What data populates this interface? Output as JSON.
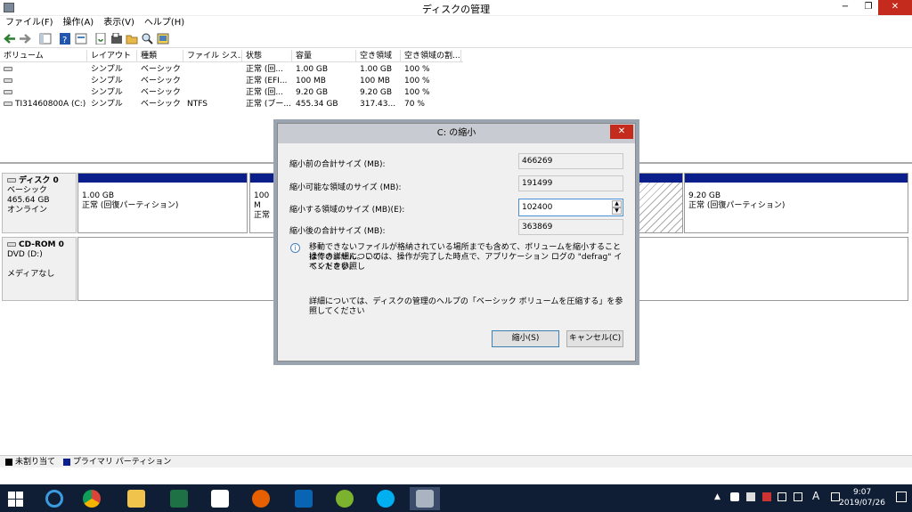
{
  "window": {
    "title": "ディスクの管理",
    "minimize": "−",
    "restore": "❐",
    "close": "✕"
  },
  "menu": [
    "ファイル(F)",
    "操作(A)",
    "表示(V)",
    "ヘルプ(H)"
  ],
  "volume_list": {
    "columns": [
      "ボリューム",
      "レイアウト",
      "種類",
      "ファイル シス...",
      "状態",
      "容量",
      "空き領域",
      "空き領域の割..."
    ],
    "rows": [
      [
        "",
        "シンプル",
        "ベーシック",
        "",
        "正常 (回...",
        "1.00 GB",
        "1.00 GB",
        "100 %"
      ],
      [
        "",
        "シンプル",
        "ベーシック",
        "",
        "正常 (EFI...",
        "100 MB",
        "100 MB",
        "100 %"
      ],
      [
        "",
        "シンプル",
        "ベーシック",
        "",
        "正常 (回...",
        "9.20 GB",
        "9.20 GB",
        "100 %"
      ],
      [
        "TI31460800A (C:)",
        "シンプル",
        "ベーシック",
        "NTFS",
        "正常 (ブー...",
        "455.34 GB",
        "317.43...",
        "70 %"
      ]
    ]
  },
  "disks": [
    {
      "name": "ディスク 0",
      "type": "ベーシック",
      "size": "465.64 GB",
      "status": "オンライン",
      "partitions": [
        {
          "size": "1.00 GB",
          "desc": "正常 (回復パーティション)"
        },
        {
          "size": "100 M",
          "desc": "正常"
        },
        {
          "size": "",
          "desc": ""
        },
        {
          "size": "9.20 GB",
          "desc": "正常 (回復パーティション)"
        }
      ]
    },
    {
      "name": "CD-ROM 0",
      "type": "DVD (D:)",
      "size": "",
      "status": "メディアなし",
      "partitions": []
    }
  ],
  "legend": {
    "unallocated": "未割り当て",
    "primary": "プライマリ パーティション",
    "colors": {
      "unallocated": "#000000",
      "primary": "#0a1e8c"
    }
  },
  "dialog": {
    "title": "C: の縮小",
    "close": "✕",
    "fields": [
      {
        "label": "縮小前の合計サイズ (MB):",
        "value": "466269"
      },
      {
        "label": "縮小可能な領域のサイズ (MB):",
        "value": "191499"
      },
      {
        "label": "縮小する領域のサイズ (MB)(E):",
        "value": "102400"
      },
      {
        "label": "縮小後の合計サイズ (MB):",
        "value": "363869"
      }
    ],
    "info_line1": "移動できないファイルが格納されている場所までも含めて、ボリュームを縮小することはできません。この",
    "info_line2": "操作の詳細については、操作が完了した時点で、アプリケーション ログの \"defrag\" イベントを参照し",
    "info_line3": "てください。",
    "help_text": "詳細については、ディスクの管理のヘルプの「ベーシック ボリュームを圧縮する」を参照してください",
    "shrink_button": "縮小(S)",
    "cancel_button": "キャンセル(C)"
  },
  "taskbar": {
    "apps": [
      "start",
      "internet-explorer",
      "chrome",
      "file-explorer",
      "excel",
      "paint",
      "firefox",
      "outlook",
      "wechat",
      "skype",
      "disk-management"
    ],
    "ime": "A",
    "time": "9:07",
    "date": "2019/07/26"
  }
}
